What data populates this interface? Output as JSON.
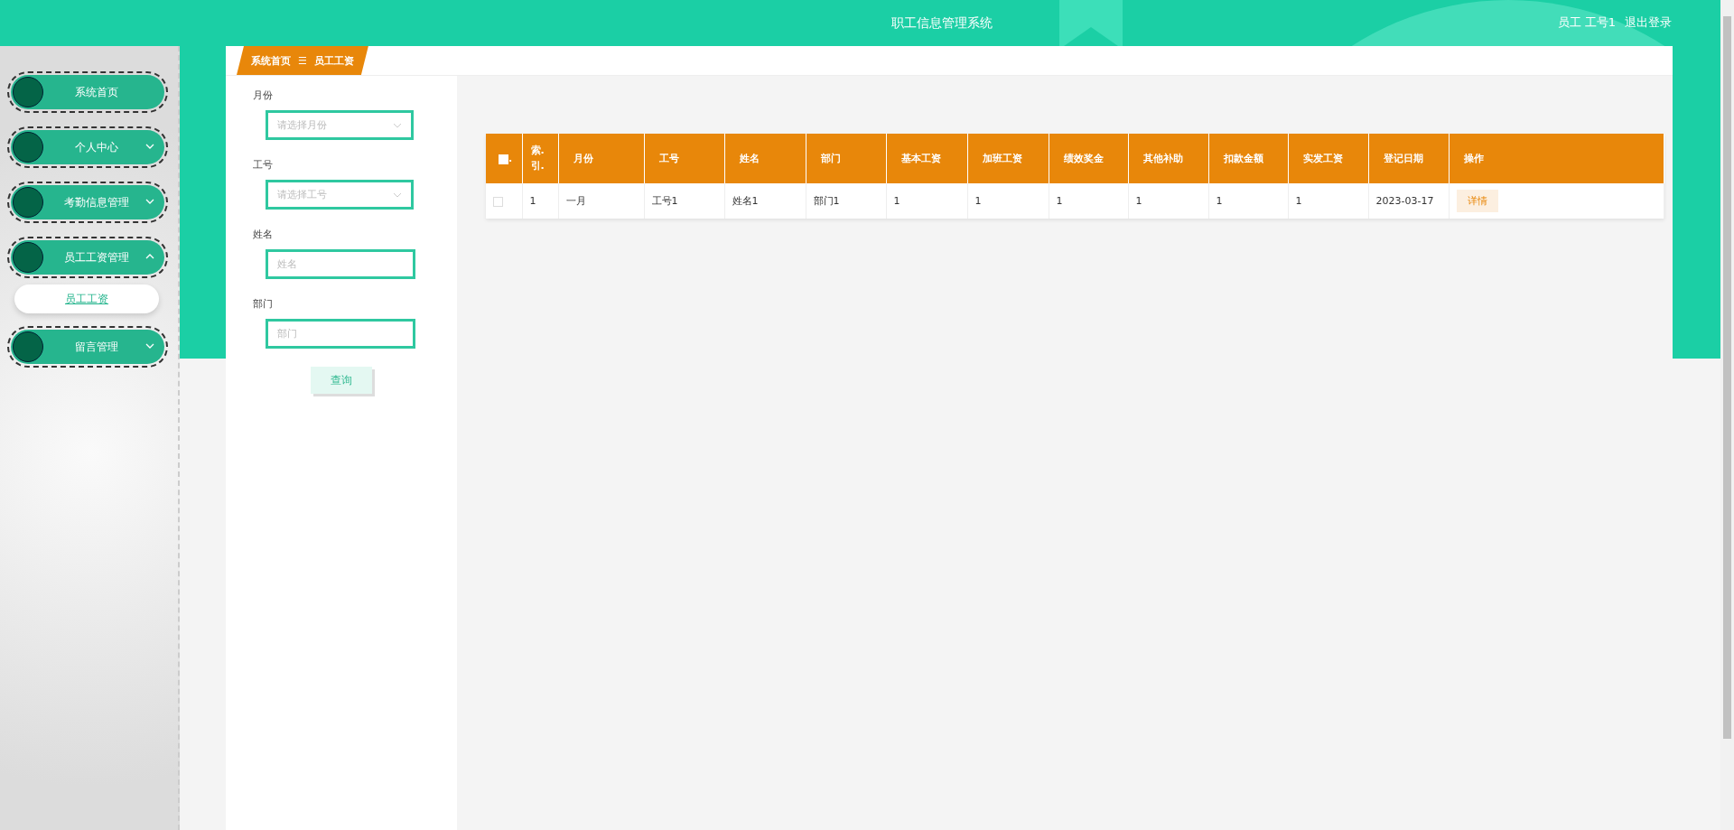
{
  "header": {
    "title": "职工信息管理系统",
    "user": "员工 工号1",
    "logout": "退出登录"
  },
  "sidebar": {
    "items": [
      {
        "label": "系统首页",
        "kind": "link"
      },
      {
        "label": "个人中心",
        "kind": "menu",
        "expanded": false
      },
      {
        "label": "考勤信息管理",
        "kind": "menu",
        "expanded": false
      },
      {
        "label": "员工工资管理",
        "kind": "menu",
        "expanded": true,
        "children": [
          {
            "label": "员工工资",
            "selected": true
          }
        ]
      },
      {
        "label": "留言管理",
        "kind": "menu",
        "expanded": false
      }
    ]
  },
  "breadcrumb": {
    "items": [
      "系统首页",
      "员工工资"
    ],
    "separator": "☰"
  },
  "filters": {
    "fields": [
      {
        "label": "月份",
        "kind": "select",
        "placeholder": "请选择月份"
      },
      {
        "label": "工号",
        "kind": "select",
        "placeholder": "请选择工号"
      },
      {
        "label": "姓名",
        "kind": "input",
        "placeholder": "姓名"
      },
      {
        "label": "部门",
        "kind": "input",
        "placeholder": "部门"
      }
    ],
    "button": "查询"
  },
  "table": {
    "select_all": {
      "checked": false,
      "label": "."
    },
    "columns": [
      "索.引.",
      "月份",
      "工号",
      "姓名",
      "部门",
      "基本工资",
      "加班工资",
      "绩效奖金",
      "其他补助",
      "扣款金额",
      "实发工资",
      "登记日期",
      "操作"
    ],
    "rows": [
      {
        "checked": false,
        "cells": [
          "1",
          "一月",
          "工号1",
          "姓名1",
          "部门1",
          "1",
          "1",
          "1",
          "1",
          "1",
          "1",
          "2023-03-17"
        ],
        "action": "详情"
      }
    ]
  }
}
